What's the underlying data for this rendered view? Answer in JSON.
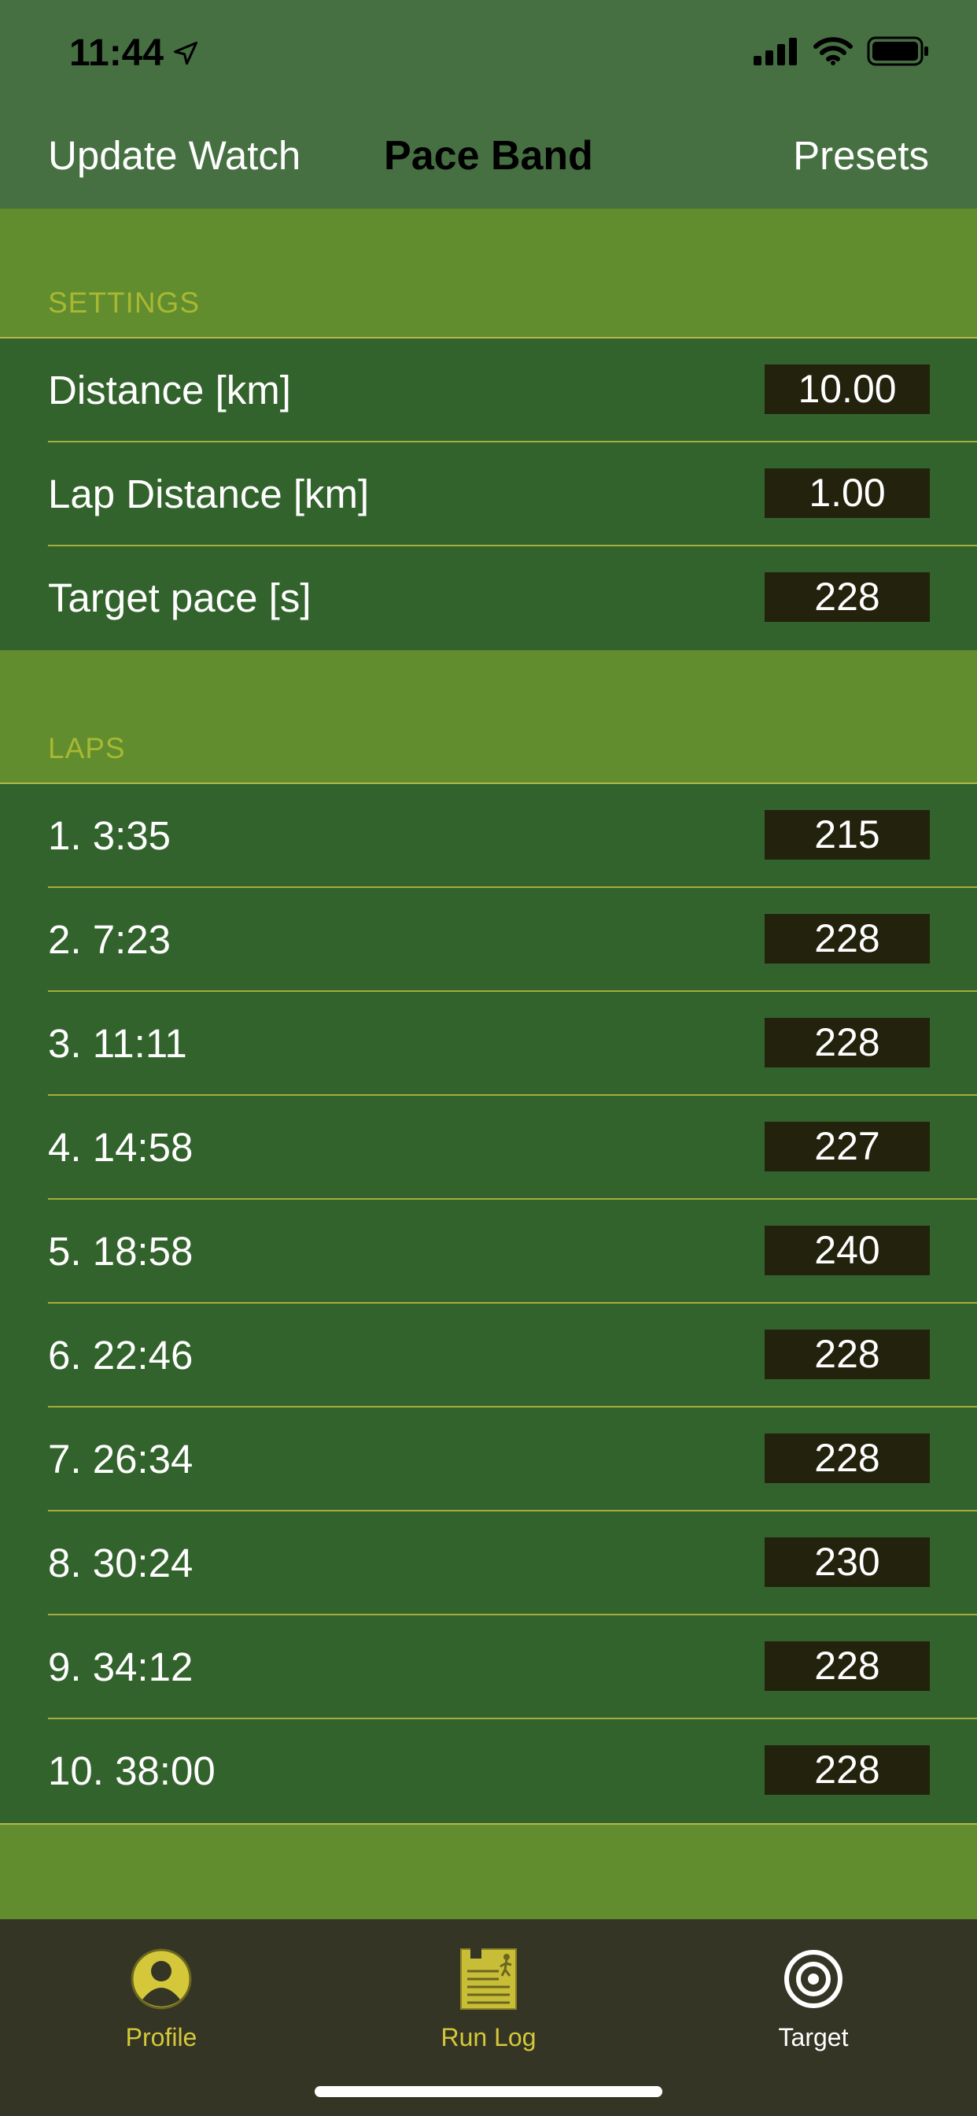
{
  "status_bar": {
    "time": "11:44"
  },
  "nav": {
    "left_label": "Update Watch",
    "title": "Pace Band",
    "right_label": "Presets"
  },
  "settings": {
    "header": "SETTINGS",
    "rows": [
      {
        "label": "Distance [km]",
        "value": "10.00"
      },
      {
        "label": "Lap Distance [km]",
        "value": "1.00"
      },
      {
        "label": "Target pace [s]",
        "value": "228"
      }
    ]
  },
  "laps": {
    "header": "LAPS",
    "rows": [
      {
        "label": "1. 3:35",
        "value": "215"
      },
      {
        "label": "2. 7:23",
        "value": "228"
      },
      {
        "label": "3. 11:11",
        "value": "228"
      },
      {
        "label": "4. 14:58",
        "value": "227"
      },
      {
        "label": "5. 18:58",
        "value": "240"
      },
      {
        "label": "6. 22:46",
        "value": "228"
      },
      {
        "label": "7. 26:34",
        "value": "228"
      },
      {
        "label": "8. 30:24",
        "value": "230"
      },
      {
        "label": "9. 34:12",
        "value": "228"
      },
      {
        "label": "10. 38:00",
        "value": "228"
      }
    ]
  },
  "tabbar": {
    "tabs": [
      {
        "label": "Profile",
        "icon": "profile-icon"
      },
      {
        "label": "Run Log",
        "icon": "run-log-icon"
      },
      {
        "label": "Target",
        "icon": "target-icon"
      }
    ],
    "selected": "Target"
  },
  "colors": {
    "nav_background": "#467042",
    "section_background": "#618d2e",
    "table_background": "#33632c",
    "value_box": "#22220d",
    "tabbar_background": "#353525",
    "tab_accent": "#d4c83a"
  }
}
